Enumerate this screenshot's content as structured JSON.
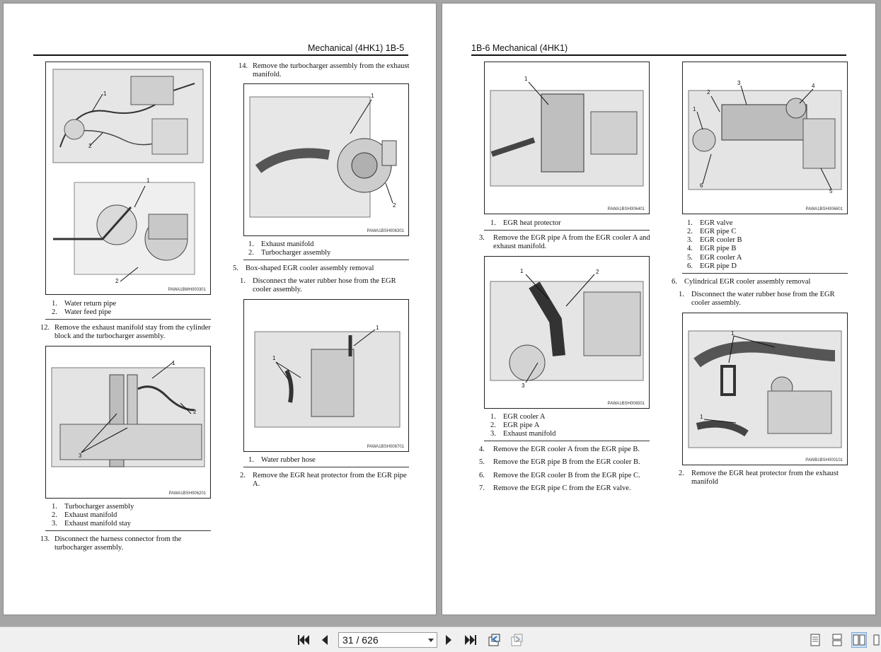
{
  "left_page": {
    "header": "Mechanical (4HK1)   1B-5",
    "figures": [
      {
        "code": "PAWA1BMH000301",
        "callouts": [
          "1",
          "2",
          "1",
          "2"
        ]
      },
      {
        "code": "PAWA1BSH006201",
        "callouts": [
          "1",
          "2",
          "3"
        ]
      },
      {
        "code": "PAWA1BSH006301",
        "callouts": [
          "1",
          "2"
        ]
      },
      {
        "code": "PAWA1BSH006701",
        "callouts": [
          "1",
          "1"
        ]
      }
    ],
    "legend_fig1": [
      {
        "n": "1.",
        "t": "Water return pipe"
      },
      {
        "n": "2.",
        "t": "Water feed pipe"
      }
    ],
    "step12": {
      "n": "12.",
      "t": "Remove the exhaust manifold stay from the cylinder block and the turbocharger assembly."
    },
    "legend_fig2": [
      {
        "n": "1.",
        "t": "Turbocharger assembly"
      },
      {
        "n": "2.",
        "t": "Exhaust manifold"
      },
      {
        "n": "3.",
        "t": "Exhaust manifold stay"
      }
    ],
    "step13": {
      "n": "13.",
      "t": "Disconnect the harness connector from the turbocharger assembly."
    },
    "step14": {
      "n": "14.",
      "t": "Remove the turbocharger assembly from the exhaust manifold."
    },
    "legend_fig3": [
      {
        "n": "1.",
        "t": "Exhaust manifold"
      },
      {
        "n": "2.",
        "t": "Turbocharger assembly"
      }
    ],
    "section5": {
      "n": "5.",
      "t": "Box-shaped EGR cooler assembly  removal"
    },
    "step5_1": {
      "n": "1.",
      "t": "Disconnect the water rubber hose from the EGR cooler assembly."
    },
    "legend_fig4": [
      {
        "n": "1.",
        "t": "Water rubber hose"
      }
    ],
    "step5_2": {
      "n": "2.",
      "t": "Remove the EGR heat protector from the EGR pipe A."
    }
  },
  "right_page": {
    "header": "1B-6   Mechanical (4HK1)",
    "figures": [
      {
        "code": "PAWA1BSH006401",
        "callouts": [
          "1"
        ]
      },
      {
        "code": "PAWA1BSH006501",
        "callouts": [
          "1",
          "2",
          "3"
        ]
      },
      {
        "code": "PAWA1BSH006601",
        "callouts": [
          "1",
          "2",
          "3",
          "4",
          "5",
          "6"
        ]
      },
      {
        "code": "PAWB1BSH000101",
        "callouts": [
          "1",
          "1"
        ]
      }
    ],
    "legend_fig1": [
      {
        "n": "1.",
        "t": "EGR heat protector"
      }
    ],
    "step3": {
      "n": "3.",
      "t": "Remove the EGR pipe A from the EGR cooler A and exhaust manifold."
    },
    "legend_fig2": [
      {
        "n": "1.",
        "t": "EGR cooler A"
      },
      {
        "n": "2.",
        "t": "EGR pipe A"
      },
      {
        "n": "3.",
        "t": "Exhaust manifold"
      }
    ],
    "step4": {
      "n": "4.",
      "t": "Remove the EGR cooler A from the EGR pipe B."
    },
    "step5": {
      "n": "5.",
      "t": "Remove the EGR pipe B from the EGR cooler B."
    },
    "step6": {
      "n": "6.",
      "t": "Remove the EGR cooler B from the EGR pipe C."
    },
    "step7": {
      "n": "7.",
      "t": "Remove the EGR pipe C from the EGR valve."
    },
    "legend_fig3": [
      {
        "n": "1.",
        "t": "EGR valve"
      },
      {
        "n": "2.",
        "t": "EGR pipe C"
      },
      {
        "n": "3.",
        "t": "EGR cooler B"
      },
      {
        "n": "4.",
        "t": "EGR pipe B"
      },
      {
        "n": "5.",
        "t": "EGR cooler A"
      },
      {
        "n": "6.",
        "t": "EGR pipe D"
      }
    ],
    "section6": {
      "n": "6.",
      "t": "Cylindrical EGR cooler assembly  removal"
    },
    "step6_1": {
      "n": "1.",
      "t": "Disconnect the water rubber hose from the EGR cooler assembly."
    },
    "step6_2": {
      "n": "2.",
      "t": "Remove the EGR heat protector from the exhaust manifold"
    }
  },
  "toolbar": {
    "page_indicator": "31 / 626",
    "icons": [
      "first-page-icon",
      "prev-page-icon",
      "next-page-icon",
      "last-page-icon",
      "go-back-icon",
      "go-forward-icon",
      "single-page-view-icon",
      "continuous-view-icon",
      "two-page-view-icon",
      "facing-view-icon"
    ]
  },
  "colors": {
    "background": "#a5a5a5",
    "page": "#ffffff",
    "toolbar": "#f0f0f0",
    "active_view": "#cfe3f7"
  }
}
